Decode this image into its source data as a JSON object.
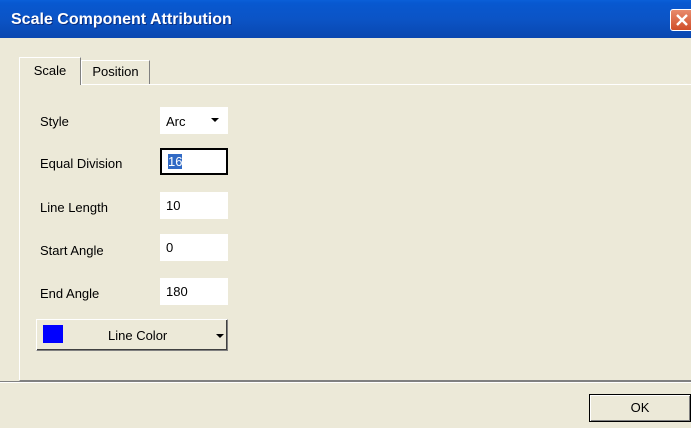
{
  "window": {
    "title": "Scale Component Attribution"
  },
  "tabs": [
    {
      "label": "Scale"
    },
    {
      "label": "Position"
    }
  ],
  "scale": {
    "style": {
      "label": "Style",
      "value": "Arc"
    },
    "equal_division": {
      "label": "Equal Division",
      "value": "16"
    },
    "line_length": {
      "label": "Line Length",
      "value": "10"
    },
    "start_angle": {
      "label": "Start Angle",
      "value": "0"
    },
    "end_angle": {
      "label": "End Angle",
      "value": "180"
    },
    "line_color": {
      "label": "Line Color",
      "color": "#0000ff"
    }
  },
  "buttons": {
    "ok_label": "OK"
  },
  "icons": {
    "close": "close-icon",
    "dropdown": "chevron-down-icon"
  }
}
